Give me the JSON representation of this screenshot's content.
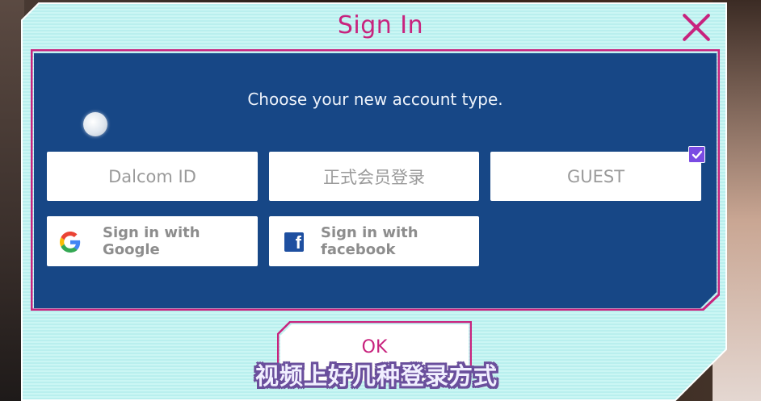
{
  "dialog": {
    "title": "Sign In",
    "prompt": "Choose your new account type.",
    "options": {
      "dalcom": "Dalcom ID",
      "official": "正式会员登录",
      "guest": "GUEST",
      "guest_checked": true
    },
    "social": {
      "google": "Sign in with Google",
      "facebook": "Sign in with facebook",
      "facebook_glyph": "f"
    },
    "ok_label": "OK"
  },
  "caption": "视频上好几种登录方式",
  "colors": {
    "accent": "#c8237e",
    "panel": "#174786",
    "dialog_bg": "#cbf6f4",
    "check": "#7a4be3",
    "facebook": "#1e4fa0"
  },
  "icons": [
    "close-icon",
    "google-icon",
    "facebook-icon",
    "checkmark-icon"
  ]
}
